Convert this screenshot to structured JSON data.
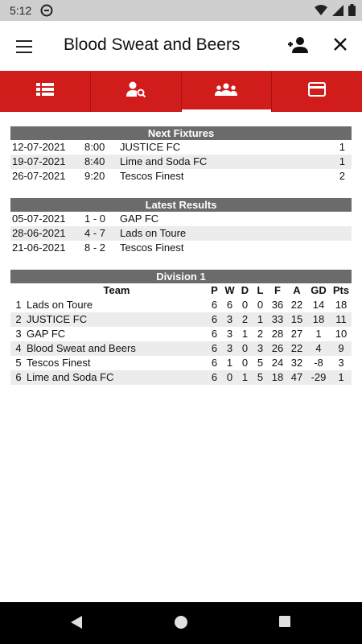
{
  "status": {
    "time": "5:12"
  },
  "appbar": {
    "title": "Blood Sweat and Beers"
  },
  "tabs": [
    {
      "icon": "list-icon"
    },
    {
      "icon": "person-search-icon"
    },
    {
      "icon": "group-icon",
      "active": true
    },
    {
      "icon": "card-icon"
    }
  ],
  "fixtures": {
    "header": "Next Fixtures",
    "rows": [
      {
        "date": "12-07-2021",
        "time": "8:00",
        "opponent": "JUSTICE FC",
        "num": "1"
      },
      {
        "date": "19-07-2021",
        "time": "8:40",
        "opponent": "Lime and Soda FC",
        "num": "1"
      },
      {
        "date": "26-07-2021",
        "time": "9:20",
        "opponent": "Tescos Finest",
        "num": "2"
      }
    ]
  },
  "results": {
    "header": "Latest Results",
    "rows": [
      {
        "date": "05-07-2021",
        "score": "1 - 0",
        "opponent": "GAP FC"
      },
      {
        "date": "28-06-2021",
        "score": "4 - 7",
        "opponent": "Lads on Toure"
      },
      {
        "date": "21-06-2021",
        "score": "8 - 2",
        "opponent": "Tescos Finest"
      }
    ]
  },
  "league": {
    "header": "Division 1",
    "columns": {
      "team": "Team",
      "p": "P",
      "w": "W",
      "d": "D",
      "l": "L",
      "f": "F",
      "a": "A",
      "gd": "GD",
      "pts": "Pts"
    },
    "rows": [
      {
        "pos": "1",
        "team": "Lads on Toure",
        "p": "6",
        "w": "6",
        "d": "0",
        "l": "0",
        "f": "36",
        "a": "22",
        "gd": "14",
        "pts": "18"
      },
      {
        "pos": "2",
        "team": "JUSTICE FC",
        "p": "6",
        "w": "3",
        "d": "2",
        "l": "1",
        "f": "33",
        "a": "15",
        "gd": "18",
        "pts": "11"
      },
      {
        "pos": "3",
        "team": "GAP FC",
        "p": "6",
        "w": "3",
        "d": "1",
        "l": "2",
        "f": "28",
        "a": "27",
        "gd": "1",
        "pts": "10"
      },
      {
        "pos": "4",
        "team": "Blood Sweat and Beers",
        "p": "6",
        "w": "3",
        "d": "0",
        "l": "3",
        "f": "26",
        "a": "22",
        "gd": "4",
        "pts": "9"
      },
      {
        "pos": "5",
        "team": "Tescos Finest",
        "p": "6",
        "w": "1",
        "d": "0",
        "l": "5",
        "f": "24",
        "a": "32",
        "gd": "-8",
        "pts": "3"
      },
      {
        "pos": "6",
        "team": "Lime and Soda FC",
        "p": "6",
        "w": "0",
        "d": "1",
        "l": "5",
        "f": "18",
        "a": "47",
        "gd": "-29",
        "pts": "1"
      }
    ]
  },
  "colors": {
    "accent": "#d11c1c",
    "header_gray": "#6b6b6b",
    "row_alt": "#ececec"
  }
}
